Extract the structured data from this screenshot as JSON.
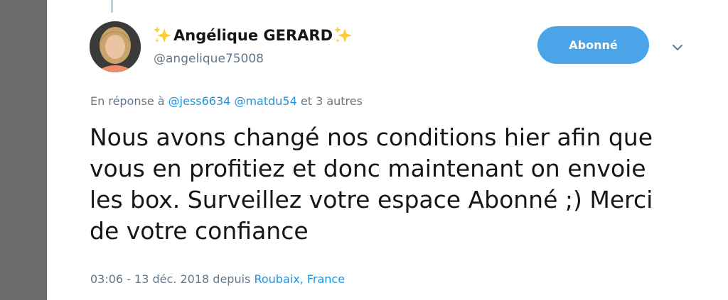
{
  "tweet": {
    "author": {
      "name": "Angélique GERARD",
      "handle": "@angelique75008",
      "name_prefix_icon": "sparkles-icon",
      "name_suffix_icon": "sparkles-icon"
    },
    "follow_button_label": "Abonné",
    "menu_icon": "chevron-down-icon",
    "reply_to": {
      "prefix": "En réponse à",
      "mentions": [
        "@jess6634",
        "@matdu54"
      ],
      "suffix": "et 3 autres"
    },
    "text": "Nous avons changé nos conditions hier afin que vous en profitiez et donc maintenant on envoie les box. Surveillez votre espace Abonné ;) Merci de votre confiance",
    "meta": {
      "time_date": "03:06 - 13 déc. 2018",
      "via": "depuis",
      "location_city": "Roubaix,",
      "location_country": "France"
    }
  },
  "colors": {
    "accent": "#1b95e0",
    "button_bg": "#4ba4e8",
    "muted_text": "#657786",
    "primary_text": "#14171a",
    "gutter": "#6d6d6d"
  }
}
